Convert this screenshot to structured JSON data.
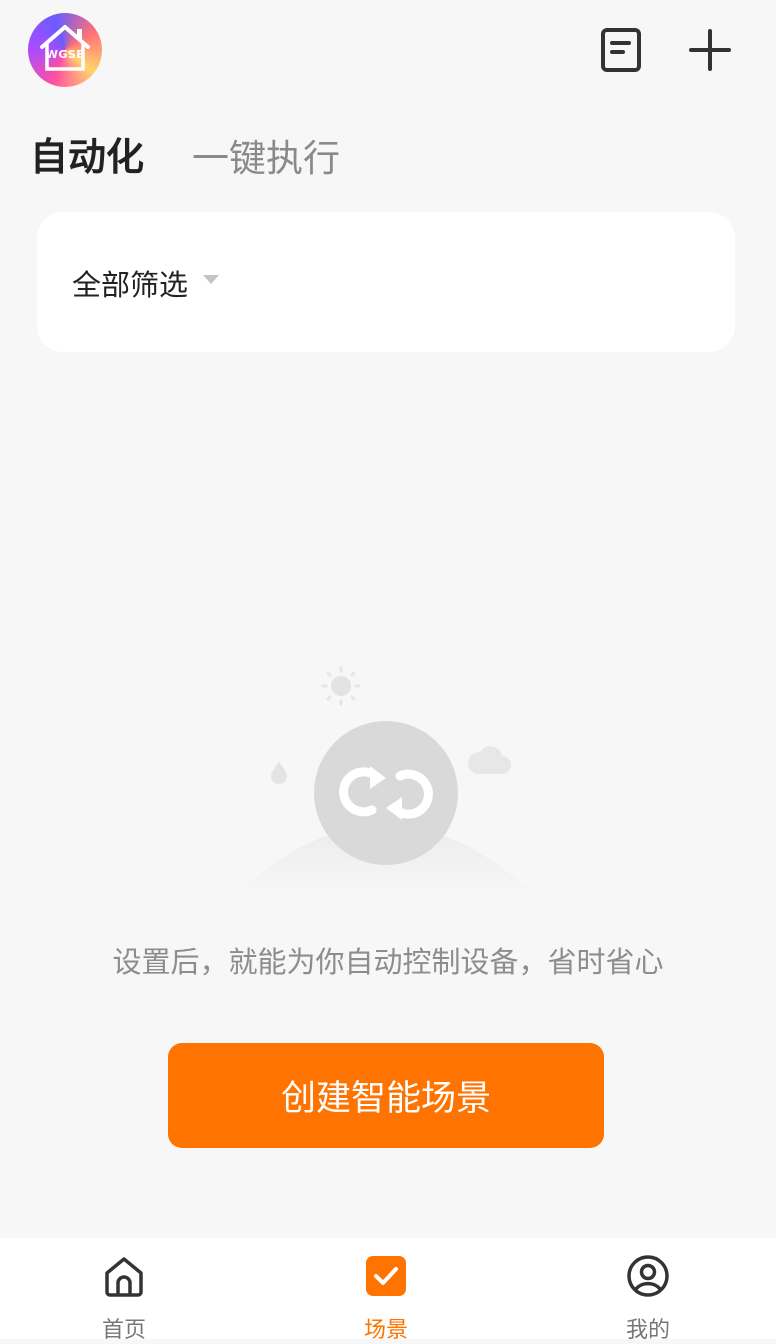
{
  "header": {
    "brand_text": "WGSE",
    "avatar_icon": "house-logo-icon",
    "log_icon": "document-icon",
    "add_icon": "plus-icon"
  },
  "tabs": {
    "automation": "自动化",
    "one_click": "一键执行"
  },
  "filter": {
    "label": "全部筛选",
    "caret_icon": "caret-down-icon"
  },
  "empty_state": {
    "illustration_icon": "loop-scene-icon",
    "message": "设置后，就能为你自动控制设备，省时省心",
    "create_button": "创建智能场景"
  },
  "bottom_nav": {
    "items": [
      {
        "label": "首页",
        "icon": "home-icon",
        "active": false
      },
      {
        "label": "场景",
        "icon": "checkbox-icon",
        "active": true
      },
      {
        "label": "我的",
        "icon": "profile-icon",
        "active": false
      }
    ]
  },
  "colors": {
    "accent": "#ff7300",
    "background": "#f7f7f7",
    "text_primary": "#222222",
    "text_secondary": "#8d8d8d"
  }
}
